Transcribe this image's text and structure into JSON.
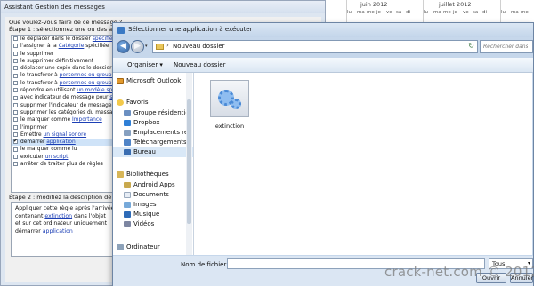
{
  "calendar": {
    "months": [
      "juin 2012",
      "juillet 2012"
    ],
    "day_groups": [
      [
        "lu",
        "ma",
        "me",
        "je",
        "ve",
        "sa",
        "di"
      ],
      [
        "lu",
        "ma",
        "me",
        "je",
        "ve",
        "sa",
        "di"
      ],
      [
        "lu",
        "ma",
        "me"
      ]
    ]
  },
  "wizard": {
    "title": "Assistant Gestion des messages",
    "question": "Que voulez-vous faire de ce message ?",
    "step1_label": "Étape 1 : sélectionnez une ou des actions",
    "conditions": [
      {
        "prefix": "le déplacer dans le dossier ",
        "link": "spécifié",
        "suffix": "",
        "checked": false,
        "selected": false
      },
      {
        "prefix": "l'assigner à la ",
        "link": "Catégorie",
        "suffix": " spécifiée",
        "checked": false,
        "selected": false
      },
      {
        "prefix": "le supprimer",
        "link": "",
        "suffix": "",
        "checked": false,
        "selected": false
      },
      {
        "prefix": "le supprimer définitivement",
        "link": "",
        "suffix": "",
        "checked": false,
        "selected": false
      },
      {
        "prefix": "déplacer une copie dans le dossier ",
        "link": "spéc",
        "suffix": "",
        "checked": false,
        "selected": false
      },
      {
        "prefix": "le transférer à ",
        "link": "personnes ou groupe pu",
        "suffix": "",
        "checked": false,
        "selected": false
      },
      {
        "prefix": "le transférer à ",
        "link": "personnes ou groupe pu",
        "suffix": "",
        "checked": false,
        "selected": false
      },
      {
        "prefix": "répondre en utilisant ",
        "link": "un modèle spécifi",
        "suffix": "",
        "checked": false,
        "selected": false
      },
      {
        "prefix": "avec indicateur de message pour ",
        "link": "suivi",
        "suffix": "",
        "checked": false,
        "selected": false
      },
      {
        "prefix": "supprimer l'indicateur de message",
        "link": "",
        "suffix": "",
        "checked": false,
        "selected": false
      },
      {
        "prefix": "supprimer les catégories du message",
        "link": "",
        "suffix": "",
        "checked": false,
        "selected": false
      },
      {
        "prefix": "le marquer comme ",
        "link": "Importance",
        "suffix": "",
        "checked": false,
        "selected": false
      },
      {
        "prefix": "l'imprimer",
        "link": "",
        "suffix": "",
        "checked": false,
        "selected": false
      },
      {
        "prefix": "Émettre ",
        "link": "un signal sonore",
        "suffix": "",
        "checked": false,
        "selected": false
      },
      {
        "prefix": "démarrer ",
        "link": "application",
        "suffix": "",
        "checked": true,
        "selected": true
      },
      {
        "prefix": "le marquer comme lu",
        "link": "",
        "suffix": "",
        "checked": false,
        "selected": false
      },
      {
        "prefix": "exécuter ",
        "link": "un script",
        "suffix": "",
        "checked": false,
        "selected": false
      },
      {
        "prefix": "arrêter de traiter plus de règles",
        "link": "",
        "suffix": "",
        "checked": false,
        "selected": false
      }
    ],
    "step2_label": "Étape 2 : modifiez la description de la règle",
    "description": [
      {
        "prefix": "Appliquer cette règle après l'arrivée du m",
        "link": "",
        "suffix": ""
      },
      {
        "prefix": "contenant ",
        "link": "extinction",
        "suffix": " dans l'objet"
      },
      {
        "prefix": "  et sur cet ordinateur uniquement",
        "link": "",
        "suffix": ""
      },
      {
        "prefix": "démarrer ",
        "link": "application",
        "suffix": ""
      }
    ]
  },
  "dialog": {
    "title": "Sélectionner une application à exécuter",
    "back_glyph": "◀",
    "forward_glyph": "▶",
    "history_glyph": "▾",
    "breadcrumb_separator": "›",
    "path": "Nouveau dossier",
    "refresh_glyph": "↻",
    "search_placeholder": "Rechercher dans",
    "organize_label": "Organiser ▾",
    "new_folder_label": "Nouveau dossier",
    "nav_items": [
      {
        "label": "Microsoft Outlook",
        "icon": "outlook-icon",
        "icon_class": "ic-outlook",
        "indent": 0,
        "selected": false
      },
      {
        "label": "Favoris",
        "icon": "star-icon",
        "icon_class": "ic-star",
        "indent": 0,
        "selected": false
      },
      {
        "label": "Groupe résidentie",
        "icon": "homegroup-icon",
        "icon_class": "ic-group",
        "indent": 1,
        "selected": false
      },
      {
        "label": "Dropbox",
        "icon": "dropbox-icon",
        "icon_class": "ic-dropbox",
        "indent": 1,
        "selected": false
      },
      {
        "label": "Emplacements ré",
        "icon": "recent-places-icon",
        "icon_class": "ic-loc",
        "indent": 1,
        "selected": false
      },
      {
        "label": "Téléchargements",
        "icon": "downloads-icon",
        "icon_class": "ic-dl",
        "indent": 1,
        "selected": false
      },
      {
        "label": "Bureau",
        "icon": "desktop-icon",
        "icon_class": "ic-desk",
        "indent": 1,
        "selected": true
      },
      {
        "label": "Bibliothèques",
        "icon": "library-icon",
        "icon_class": "ic-lib",
        "indent": 0,
        "selected": false
      },
      {
        "label": "Android Apps",
        "icon": "folder-icon",
        "icon_class": "ic-android",
        "indent": 1,
        "selected": false
      },
      {
        "label": "Documents",
        "icon": "documents-icon",
        "icon_class": "ic-docs",
        "indent": 1,
        "selected": false
      },
      {
        "label": "Images",
        "icon": "images-icon",
        "icon_class": "ic-img",
        "indent": 1,
        "selected": false
      },
      {
        "label": "Musique",
        "icon": "music-icon",
        "icon_class": "ic-music",
        "indent": 1,
        "selected": false
      },
      {
        "label": "Vidéos",
        "icon": "videos-icon",
        "icon_class": "ic-video",
        "indent": 1,
        "selected": false
      },
      {
        "label": "Ordinateur",
        "icon": "computer-icon",
        "icon_class": "ic-pc",
        "indent": 0,
        "selected": false
      }
    ],
    "files": [
      {
        "name": "extinction",
        "icon": "gear-application-icon"
      }
    ],
    "filename_label": "Nom de fichier :",
    "filename_value": "",
    "filter_value": "Tous",
    "open_label": "Ouvrir",
    "cancel_label": "Annuler"
  },
  "watermark": "crack-net.com © 2012"
}
